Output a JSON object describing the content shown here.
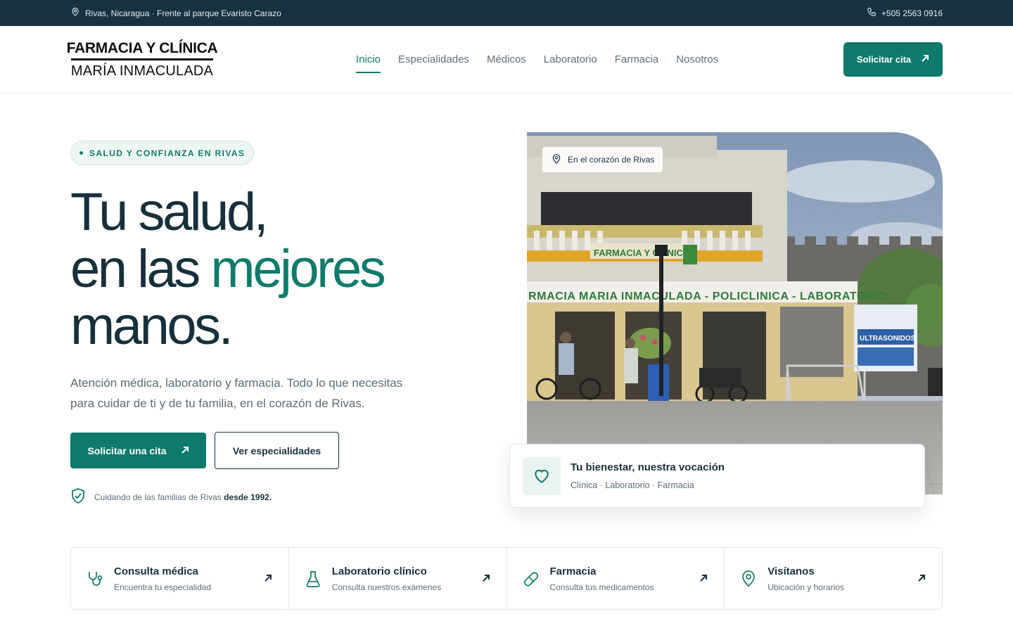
{
  "topbar": {
    "address": "Rivas, Nicaragua · Frente al parque Evaristo Carazo",
    "phone": "+505 2563 0916",
    "icons": {
      "address": "map-pin-icon",
      "phone": "phone-icon"
    }
  },
  "header": {
    "logo_line1": "FARMACIA Y CLÍNICA",
    "logo_line2": "MARÍA INMACULADA",
    "nav": [
      {
        "label": "Inicio",
        "active": true
      },
      {
        "label": "Especialidades"
      },
      {
        "label": "Médicos"
      },
      {
        "label": "Laboratorio"
      },
      {
        "label": "Farmacia"
      },
      {
        "label": "Nosotros"
      }
    ],
    "cta_label": "Solicitar cita"
  },
  "hero": {
    "badge": "SALUD Y CONFIANZA EN RIVAS",
    "headline_line1": "Tu salud,",
    "headline_line2_a": "en las ",
    "headline_line2_accent": "mejores",
    "headline_line3": "manos.",
    "lead": "Atención médica, laboratorio y farmacia. Todo lo que necesitas para cuidar de ti y de tu familia, en el corazón de Rivas.",
    "primary_cta": "Solicitar una cita",
    "secondary_cta": "Ver especialidades",
    "trust_text": "Cuidando de las familias de Rivas ",
    "trust_bold": "desde 1992."
  },
  "photo": {
    "location_badge": "En el corazón de Rivas",
    "sign_text_1": "FARMACIA Y CLÍNICA",
    "sign_text_2": "RMACIA MARIA INMACULADA - POLICLINICA - LABORATORIO",
    "sign_text_3": "ULTRASONIDOS"
  },
  "feature_card": {
    "title": "Tu bienestar, nuestra vocación",
    "subtitle": "Clínica · Laboratorio · Farmacia",
    "icon": "heart-icon"
  },
  "services": [
    {
      "title": "Consulta médica",
      "subtitle": "Encuentra tu especialidad",
      "icon": "stethoscope-icon"
    },
    {
      "title": "Laboratorio clínico",
      "subtitle": "Consulta nuestros exámenes",
      "icon": "flask-icon"
    },
    {
      "title": "Farmacia",
      "subtitle": "Consulta tus medicamentos",
      "icon": "pill-icon"
    },
    {
      "title": "Visítanos",
      "subtitle": "Ubicación y horarios",
      "icon": "map-pin-icon"
    }
  ],
  "colors": {
    "primary": "#0e7a6b",
    "dark": "#163241",
    "text_muted": "#5b6c75"
  }
}
